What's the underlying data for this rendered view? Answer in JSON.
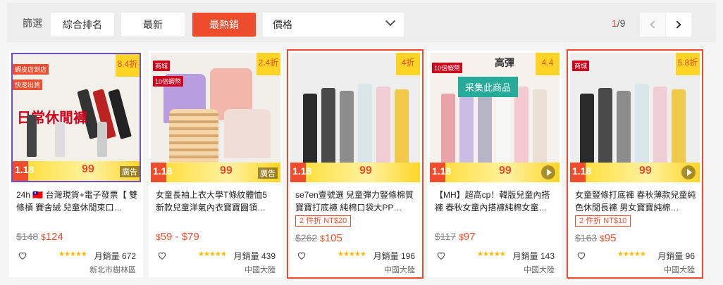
{
  "sortbar": {
    "label": "篩選",
    "options": [
      "綜合排名",
      "最新",
      "最熱銷"
    ],
    "price_label": "價格",
    "pager": {
      "current": "1",
      "total": "/9"
    }
  },
  "products": [
    {
      "title": "24h 🇹🇼 台灣現貨+電子發票【 雙條槓 賽舍絨 兒童休閒束口…",
      "orig_price": "$148",
      "price": "124",
      "discount": "8.4折",
      "badges": [
        "蝦皮店到店",
        "快速出貨"
      ],
      "promo": "",
      "sold": "月銷量 672",
      "location": "新北市樹林區",
      "ad": "廣告",
      "overlay_text": "日常休閒褲"
    },
    {
      "title": "女童長袖上衣大學T條紋體恤5 新款兒童洋氣內衣寶寶圓領…",
      "orig_price": "",
      "price": "59 - $79",
      "discount": "2.4折",
      "badges": [
        "商城",
        "10倍蝦幣"
      ],
      "promo": "",
      "sold": "月銷量 439",
      "location": "中國大陸",
      "ad": "廣告"
    },
    {
      "title": "se7en壹號選 兒童彈力豎條棉質寶寶打底褲 純棉口袋大PP…",
      "orig_price": "$262",
      "price": "105",
      "discount": "4折",
      "badges": [],
      "promo": "2 件折 NT$20",
      "sold": "月銷量 196",
      "location": "中國大陸"
    },
    {
      "title": "【MH】超高cp！韓版兒童內搭褲 春秋女童內搭褲純棉女童…",
      "orig_price": "$117",
      "price": "97",
      "discount": "4.4",
      "badges": [
        "10倍蝦幣"
      ],
      "promo": "",
      "sold": "月銷量 143",
      "location": "中國大陸",
      "collect": "采集此商品",
      "overlay_text": "高彈"
    },
    {
      "title": "女童豎條打底褲 春秋薄款兒童純色休閒長褲 男女寶寶純棉…",
      "orig_price": "$163",
      "price": "95",
      "discount": "5.8折",
      "badges": [
        "商城"
      ],
      "promo": "2 件折 NT$10",
      "sold": "月銷量 96",
      "location": "中國大陸"
    }
  ],
  "strip": {
    "d118": "1.18",
    "d99": "99"
  },
  "currency": "$",
  "stars": "★★★★★"
}
